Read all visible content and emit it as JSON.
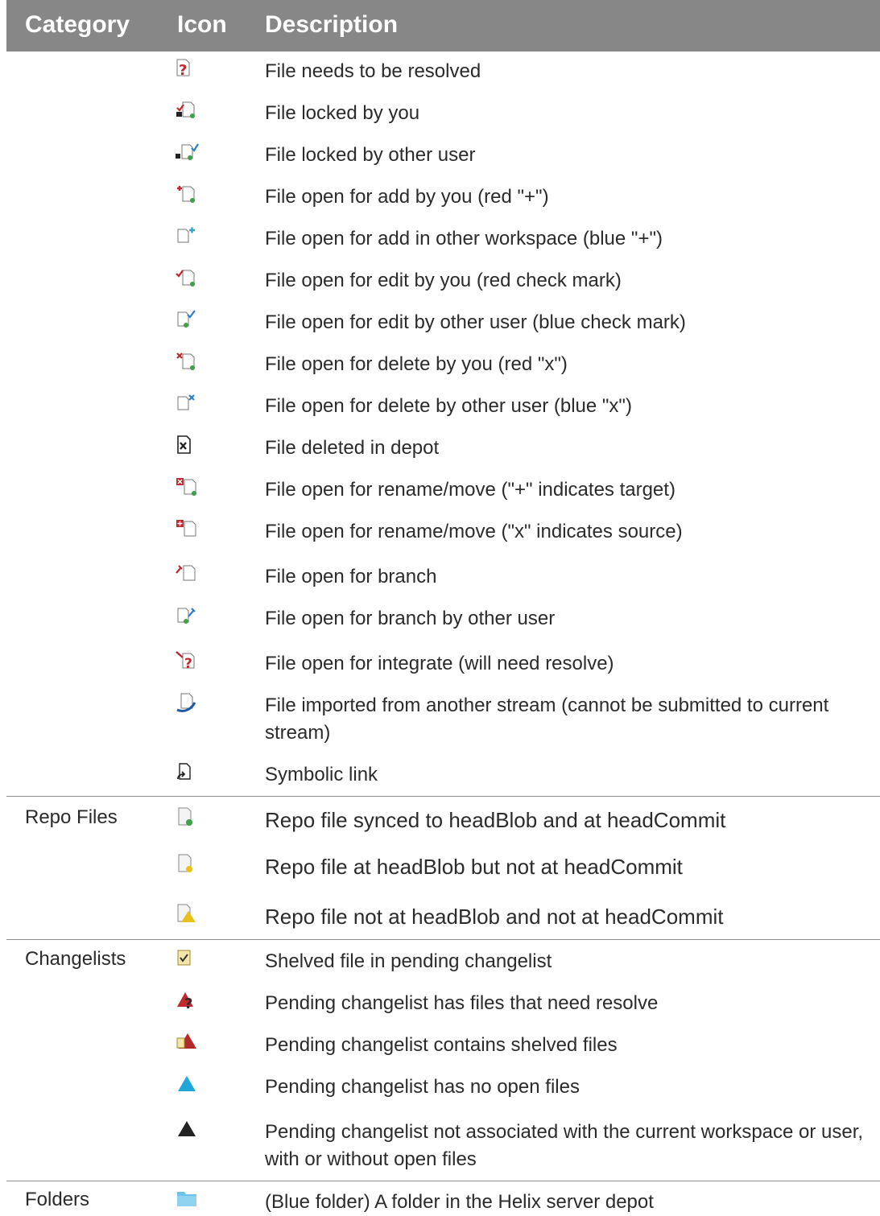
{
  "header": {
    "category": "Category",
    "icon": "Icon",
    "description": "Description"
  },
  "sections": [
    {
      "category": "",
      "rows": [
        {
          "icon": "file-needs-resolve-icon",
          "text": "File needs to be resolved"
        },
        {
          "icon": "file-locked-by-you-icon",
          "text": "File locked by you"
        },
        {
          "icon": "file-locked-by-other-icon",
          "text": "File locked by other user"
        },
        {
          "icon": "file-add-by-you-icon",
          "text": "File open for add by you (red \"+\")"
        },
        {
          "icon": "file-add-other-icon",
          "text": "File open for add in other workspace (blue \"+\")"
        },
        {
          "icon": "file-edit-by-you-icon",
          "text": "File open for edit by you (red check mark)"
        },
        {
          "icon": "file-edit-other-icon",
          "text": "File open for edit by other user (blue check mark)"
        },
        {
          "icon": "file-delete-by-you-icon",
          "text": "File open for delete by you (red \"x\")"
        },
        {
          "icon": "file-delete-other-icon",
          "text": "File open for delete by other user (blue \"x\")"
        },
        {
          "icon": "file-deleted-depot-icon",
          "text": "File deleted in depot"
        },
        {
          "icon": "file-rename-target-icon",
          "text": "File open for rename/move (\"+\" indicates target)"
        },
        {
          "icon": "file-rename-source-icon",
          "text": "File open for rename/move (\"x\" indicates source)"
        },
        {
          "icon": "file-branch-icon",
          "text": "File open for branch"
        },
        {
          "icon": "file-branch-other-icon",
          "text": "File open for branch by other user"
        },
        {
          "icon": "file-integrate-icon",
          "text": "File open for integrate (will need resolve)"
        },
        {
          "icon": "file-imported-icon",
          "text": "File imported from another stream (cannot be submitted to current stream)"
        },
        {
          "icon": "symbolic-link-icon",
          "text": "Symbolic link"
        }
      ]
    },
    {
      "category": "Repo Files",
      "rows": [
        {
          "icon": "repo-synced-icon",
          "text": "Repo file synced to headBlob and at headCommit"
        },
        {
          "icon": "repo-headblob-icon",
          "text": "Repo file at headBlob but not at headCommit"
        },
        {
          "icon": "repo-not-head-icon",
          "text": "Repo file not at headBlob and not at headCommit"
        }
      ]
    },
    {
      "category": "Changelists",
      "rows": [
        {
          "icon": "shelved-file-icon",
          "text": "Shelved file in pending changelist"
        },
        {
          "icon": "changelist-resolve-icon",
          "text": "Pending changelist has files that need resolve"
        },
        {
          "icon": "changelist-shelved-icon",
          "text": "Pending changelist contains shelved files"
        },
        {
          "icon": "changelist-empty-icon",
          "text": "Pending changelist has no open files"
        },
        {
          "icon": "changelist-other-workspace-icon",
          "text": "Pending changelist not associated with the current workspace or user, with or without open files"
        }
      ]
    },
    {
      "category": "Folders",
      "rows": [
        {
          "icon": "blue-folder-icon",
          "text": "(Blue folder) A folder in the Helix server depot"
        }
      ]
    }
  ]
}
